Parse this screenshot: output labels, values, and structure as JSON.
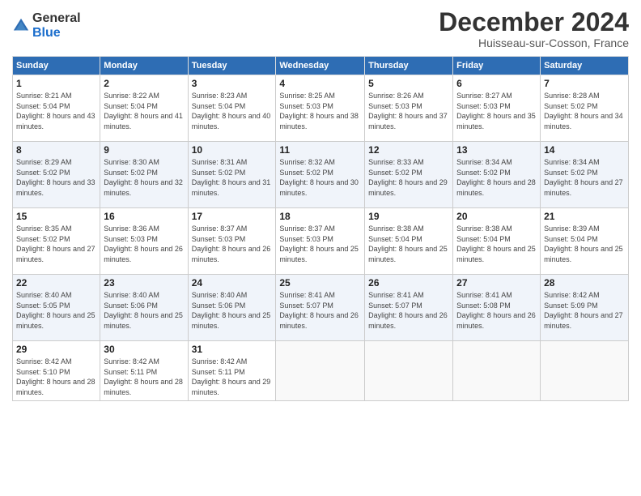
{
  "logo": {
    "general": "General",
    "blue": "Blue"
  },
  "header": {
    "month": "December 2024",
    "location": "Huisseau-sur-Cosson, France"
  },
  "weekdays": [
    "Sunday",
    "Monday",
    "Tuesday",
    "Wednesday",
    "Thursday",
    "Friday",
    "Saturday"
  ],
  "weeks": [
    [
      {
        "day": "1",
        "sunrise": "Sunrise: 8:21 AM",
        "sunset": "Sunset: 5:04 PM",
        "daylight": "Daylight: 8 hours and 43 minutes."
      },
      {
        "day": "2",
        "sunrise": "Sunrise: 8:22 AM",
        "sunset": "Sunset: 5:04 PM",
        "daylight": "Daylight: 8 hours and 41 minutes."
      },
      {
        "day": "3",
        "sunrise": "Sunrise: 8:23 AM",
        "sunset": "Sunset: 5:04 PM",
        "daylight": "Daylight: 8 hours and 40 minutes."
      },
      {
        "day": "4",
        "sunrise": "Sunrise: 8:25 AM",
        "sunset": "Sunset: 5:03 PM",
        "daylight": "Daylight: 8 hours and 38 minutes."
      },
      {
        "day": "5",
        "sunrise": "Sunrise: 8:26 AM",
        "sunset": "Sunset: 5:03 PM",
        "daylight": "Daylight: 8 hours and 37 minutes."
      },
      {
        "day": "6",
        "sunrise": "Sunrise: 8:27 AM",
        "sunset": "Sunset: 5:03 PM",
        "daylight": "Daylight: 8 hours and 35 minutes."
      },
      {
        "day": "7",
        "sunrise": "Sunrise: 8:28 AM",
        "sunset": "Sunset: 5:02 PM",
        "daylight": "Daylight: 8 hours and 34 minutes."
      }
    ],
    [
      {
        "day": "8",
        "sunrise": "Sunrise: 8:29 AM",
        "sunset": "Sunset: 5:02 PM",
        "daylight": "Daylight: 8 hours and 33 minutes."
      },
      {
        "day": "9",
        "sunrise": "Sunrise: 8:30 AM",
        "sunset": "Sunset: 5:02 PM",
        "daylight": "Daylight: 8 hours and 32 minutes."
      },
      {
        "day": "10",
        "sunrise": "Sunrise: 8:31 AM",
        "sunset": "Sunset: 5:02 PM",
        "daylight": "Daylight: 8 hours and 31 minutes."
      },
      {
        "day": "11",
        "sunrise": "Sunrise: 8:32 AM",
        "sunset": "Sunset: 5:02 PM",
        "daylight": "Daylight: 8 hours and 30 minutes."
      },
      {
        "day": "12",
        "sunrise": "Sunrise: 8:33 AM",
        "sunset": "Sunset: 5:02 PM",
        "daylight": "Daylight: 8 hours and 29 minutes."
      },
      {
        "day": "13",
        "sunrise": "Sunrise: 8:34 AM",
        "sunset": "Sunset: 5:02 PM",
        "daylight": "Daylight: 8 hours and 28 minutes."
      },
      {
        "day": "14",
        "sunrise": "Sunrise: 8:34 AM",
        "sunset": "Sunset: 5:02 PM",
        "daylight": "Daylight: 8 hours and 27 minutes."
      }
    ],
    [
      {
        "day": "15",
        "sunrise": "Sunrise: 8:35 AM",
        "sunset": "Sunset: 5:02 PM",
        "daylight": "Daylight: 8 hours and 27 minutes."
      },
      {
        "day": "16",
        "sunrise": "Sunrise: 8:36 AM",
        "sunset": "Sunset: 5:03 PM",
        "daylight": "Daylight: 8 hours and 26 minutes."
      },
      {
        "day": "17",
        "sunrise": "Sunrise: 8:37 AM",
        "sunset": "Sunset: 5:03 PM",
        "daylight": "Daylight: 8 hours and 26 minutes."
      },
      {
        "day": "18",
        "sunrise": "Sunrise: 8:37 AM",
        "sunset": "Sunset: 5:03 PM",
        "daylight": "Daylight: 8 hours and 25 minutes."
      },
      {
        "day": "19",
        "sunrise": "Sunrise: 8:38 AM",
        "sunset": "Sunset: 5:04 PM",
        "daylight": "Daylight: 8 hours and 25 minutes."
      },
      {
        "day": "20",
        "sunrise": "Sunrise: 8:38 AM",
        "sunset": "Sunset: 5:04 PM",
        "daylight": "Daylight: 8 hours and 25 minutes."
      },
      {
        "day": "21",
        "sunrise": "Sunrise: 8:39 AM",
        "sunset": "Sunset: 5:04 PM",
        "daylight": "Daylight: 8 hours and 25 minutes."
      }
    ],
    [
      {
        "day": "22",
        "sunrise": "Sunrise: 8:40 AM",
        "sunset": "Sunset: 5:05 PM",
        "daylight": "Daylight: 8 hours and 25 minutes."
      },
      {
        "day": "23",
        "sunrise": "Sunrise: 8:40 AM",
        "sunset": "Sunset: 5:06 PM",
        "daylight": "Daylight: 8 hours and 25 minutes."
      },
      {
        "day": "24",
        "sunrise": "Sunrise: 8:40 AM",
        "sunset": "Sunset: 5:06 PM",
        "daylight": "Daylight: 8 hours and 25 minutes."
      },
      {
        "day": "25",
        "sunrise": "Sunrise: 8:41 AM",
        "sunset": "Sunset: 5:07 PM",
        "daylight": "Daylight: 8 hours and 26 minutes."
      },
      {
        "day": "26",
        "sunrise": "Sunrise: 8:41 AM",
        "sunset": "Sunset: 5:07 PM",
        "daylight": "Daylight: 8 hours and 26 minutes."
      },
      {
        "day": "27",
        "sunrise": "Sunrise: 8:41 AM",
        "sunset": "Sunset: 5:08 PM",
        "daylight": "Daylight: 8 hours and 26 minutes."
      },
      {
        "day": "28",
        "sunrise": "Sunrise: 8:42 AM",
        "sunset": "Sunset: 5:09 PM",
        "daylight": "Daylight: 8 hours and 27 minutes."
      }
    ],
    [
      {
        "day": "29",
        "sunrise": "Sunrise: 8:42 AM",
        "sunset": "Sunset: 5:10 PM",
        "daylight": "Daylight: 8 hours and 28 minutes."
      },
      {
        "day": "30",
        "sunrise": "Sunrise: 8:42 AM",
        "sunset": "Sunset: 5:11 PM",
        "daylight": "Daylight: 8 hours and 28 minutes."
      },
      {
        "day": "31",
        "sunrise": "Sunrise: 8:42 AM",
        "sunset": "Sunset: 5:11 PM",
        "daylight": "Daylight: 8 hours and 29 minutes."
      },
      null,
      null,
      null,
      null
    ]
  ]
}
